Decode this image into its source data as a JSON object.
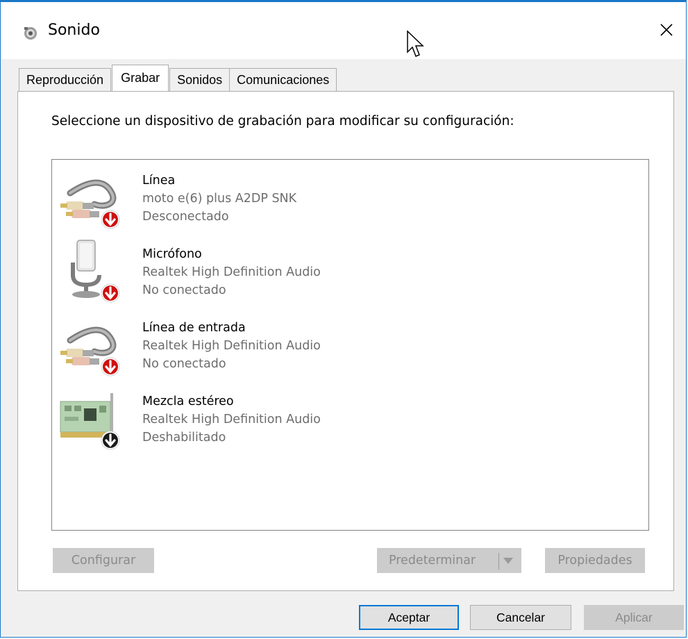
{
  "window": {
    "title": "Sonido",
    "close_symbol": "✕"
  },
  "tabs": [
    {
      "label": "Reproducción",
      "active": false
    },
    {
      "label": "Grabar",
      "active": true
    },
    {
      "label": "Sonidos",
      "active": false
    },
    {
      "label": "Comunicaciones",
      "active": false
    }
  ],
  "instructions": "Seleccione un dispositivo de grabación para modificar su configuración:",
  "devices": [
    {
      "name": "Línea",
      "driver": "moto e(6) plus A2DP SNK",
      "status": "Desconectado",
      "icon": "rca-cable-icon",
      "badge": "red"
    },
    {
      "name": "Micrófono",
      "driver": "Realtek High Definition Audio",
      "status": "No conectado",
      "icon": "microphone-icon",
      "badge": "red"
    },
    {
      "name": "Línea de entrada",
      "driver": "Realtek High Definition Audio",
      "status": "No conectado",
      "icon": "rca-cable-icon",
      "badge": "red"
    },
    {
      "name": "Mezcla estéreo",
      "driver": "Realtek High Definition Audio",
      "status": "Deshabilitado",
      "icon": "sound-card-icon",
      "badge": "black"
    }
  ],
  "buttons": {
    "configure": "Configurar",
    "set_default": "Predeterminar",
    "properties": "Propiedades",
    "ok": "Aceptar",
    "cancel": "Cancelar",
    "apply": "Aplicar"
  },
  "colors": {
    "accent": "#0078d7",
    "badge_red": "#d01010",
    "badge_black": "#1a1a1a",
    "disabled_text": "#8a8a8a"
  }
}
